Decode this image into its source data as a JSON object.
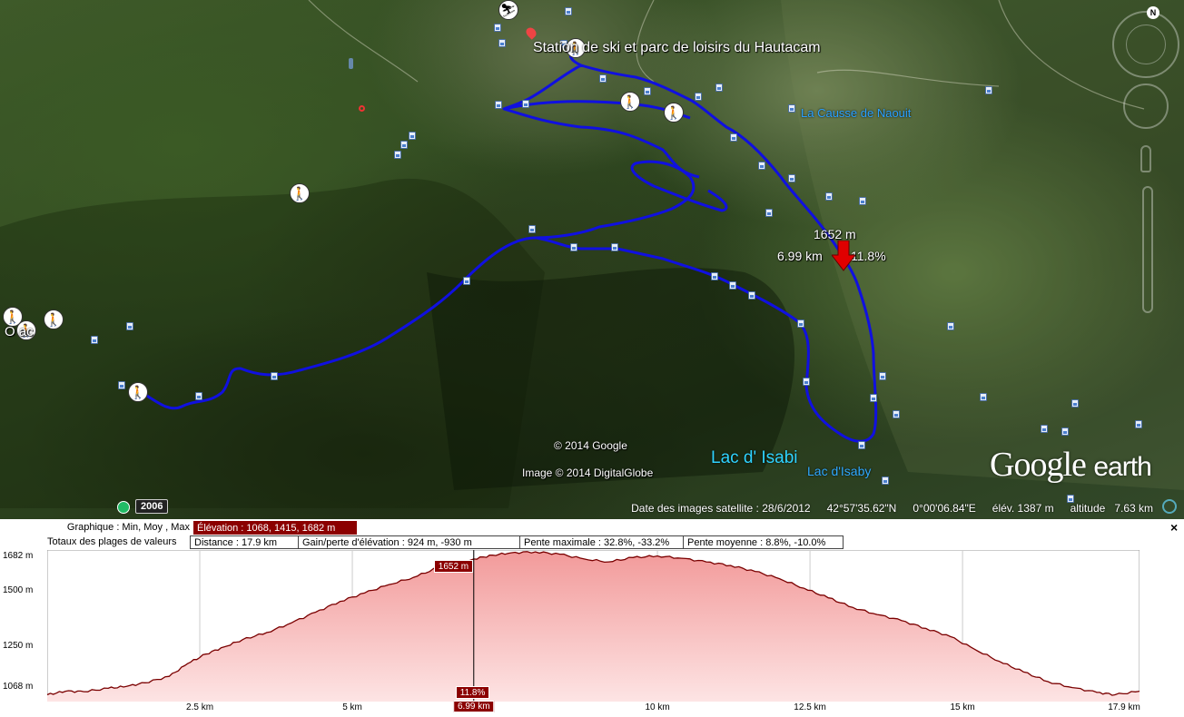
{
  "map": {
    "place_labels": {
      "station": "Station de ski et parc de loisirs du Hautacam",
      "la_causse": "La Causse de Naouit",
      "lac_isabi": "Lac d' Isabi",
      "lac_isaby": "Lac d'Isaby",
      "west_village": "O      ac"
    },
    "cursor_marker": {
      "elevation": "1652 m",
      "distance": "6.99 km",
      "slope": "11.8%"
    },
    "copyright": {
      "google": "© 2014 Google",
      "image": "Image © 2014 DigitalGlobe"
    },
    "logo": {
      "word1": "Google",
      "word2": "earth"
    },
    "historical_year": "2006",
    "compass_letter": "N",
    "statusbar": {
      "imagery_date": "Date des images satellite : 28/6/2012",
      "latitude": "42°57'35.62\"N",
      "longitude": "0°00'06.84\"E",
      "elevation": "élév.  1387 m",
      "altitude_label": "altitude",
      "altitude_value": "7.63 km"
    },
    "colors": {
      "track": "#1010e0",
      "marker": "#e00000"
    }
  },
  "profile": {
    "row1": {
      "label": "Graphique : Min, Moy , Max",
      "elevation": "Élévation : 1068, 1415, 1682 m"
    },
    "row2": {
      "label": "Totaux des plages de valeurs",
      "distance": "Distance : 17.9 km",
      "gain": "Gain/perte d'élévation : 924 m, -930 m",
      "max_slope": "Pente maximale : 32.8%, -33.2%",
      "avg_slope": "Pente moyenne : 8.8%, -10.0%"
    },
    "close": "×",
    "y_ticks": [
      "1682 m",
      "1500 m",
      "1250 m",
      "1068 m"
    ],
    "x_ticks": [
      "2.5 km",
      "5 km",
      "6.99 km",
      "10 km",
      "12.5 km",
      "15 km",
      "17.9 km"
    ],
    "cursor_flag_top": "1652 m",
    "cursor_flag_bottom": "11.8%",
    "colors": {
      "line": "#7a0000",
      "fill_top": "#f29a9a",
      "fill_bottom": "#fde4e4",
      "flag": "#8b0000"
    },
    "chart_data": {
      "type": "area",
      "xlabel": "",
      "ylabel": "",
      "xlim": [
        0,
        17.9
      ],
      "ylim": [
        1068,
        1682
      ],
      "x": [
        0,
        0.3,
        0.6,
        1.0,
        1.3,
        1.6,
        2.0,
        2.3,
        2.6,
        2.9,
        3.2,
        3.6,
        4.0,
        4.4,
        4.8,
        5.2,
        5.6,
        6.0,
        6.4,
        6.99,
        7.3,
        7.6,
        8.0,
        8.4,
        8.8,
        9.2,
        9.6,
        10.0,
        10.4,
        10.8,
        11.2,
        11.6,
        12.0,
        12.4,
        12.8,
        13.2,
        13.6,
        14.0,
        14.4,
        14.8,
        15.2,
        15.6,
        16.0,
        16.4,
        16.8,
        17.2,
        17.5,
        17.9
      ],
      "elevation": [
        1085,
        1100,
        1098,
        1112,
        1120,
        1135,
        1162,
        1215,
        1255,
        1285,
        1315,
        1345,
        1385,
        1430,
        1475,
        1510,
        1545,
        1575,
        1615,
        1652,
        1668,
        1678,
        1682,
        1672,
        1652,
        1640,
        1658,
        1665,
        1655,
        1640,
        1625,
        1600,
        1570,
        1530,
        1490,
        1450,
        1420,
        1395,
        1362,
        1328,
        1275,
        1225,
        1180,
        1140,
        1115,
        1095,
        1085,
        1100
      ]
    }
  }
}
